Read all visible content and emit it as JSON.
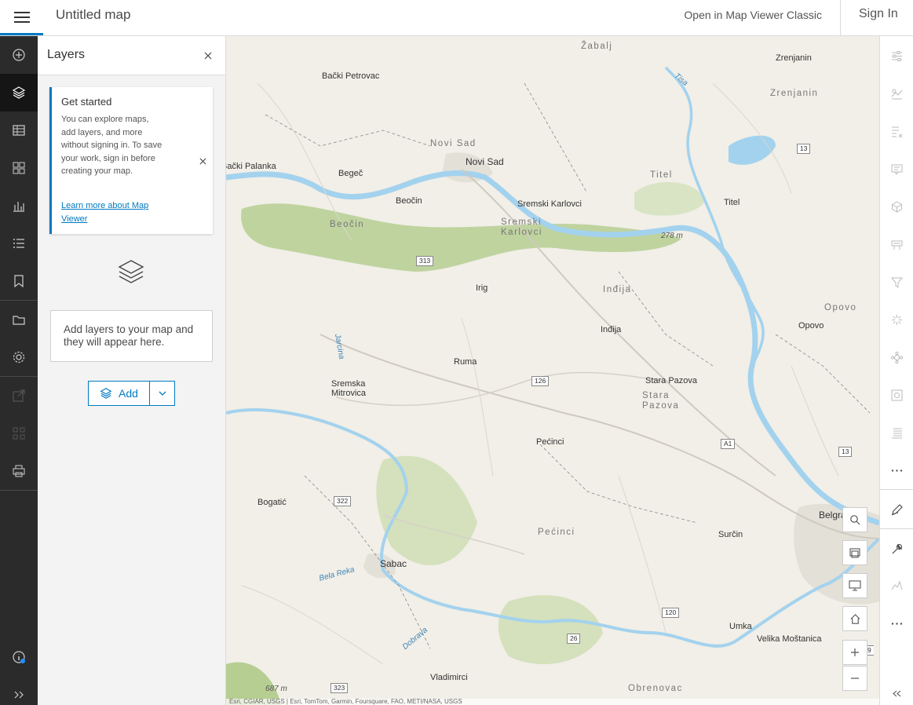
{
  "header": {
    "title": "Untitled map",
    "open_classic_label": "Open in Map Viewer Classic",
    "sign_in_label": "Sign In"
  },
  "left_rail": {
    "items": [
      {
        "icon": "add-circle-icon",
        "active": false
      },
      {
        "icon": "layers-icon",
        "active": true
      },
      {
        "icon": "table-icon",
        "active": false
      },
      {
        "icon": "grid-icon",
        "active": false
      },
      {
        "icon": "chart-icon",
        "active": false
      },
      {
        "icon": "legend-list-icon",
        "active": false
      },
      {
        "icon": "bookmark-icon",
        "active": false
      },
      {
        "icon": "folder-icon",
        "active": false
      },
      {
        "icon": "gear-icon",
        "active": false
      },
      {
        "icon": "share-icon",
        "active": false
      },
      {
        "icon": "apps-icon",
        "active": false
      },
      {
        "icon": "print-icon",
        "active": false
      },
      {
        "icon": "info-icon",
        "active": false
      },
      {
        "icon": "expand-icon",
        "active": false
      }
    ]
  },
  "layers_panel": {
    "title": "Layers",
    "get_started": {
      "title": "Get started",
      "body": "You can explore maps, add layers, and more without signing in. To save your work, sign in before creating your map.",
      "link": "Learn more about Map Viewer"
    },
    "empty_message": "Add layers to your map and they will appear here.",
    "add_label": "Add"
  },
  "map": {
    "place_labels": [
      "Zrenjanin",
      "Bački Petrovac",
      "Novi Sad",
      "Bački Palanka",
      "Begeč",
      "Beočin",
      "Sremski Karlovci",
      "Titel",
      "Irig",
      "Inđija",
      "Opovo",
      "Ruma",
      "Sremska Mitrovica",
      "Stara Pazova",
      "Pećinci",
      "Bogatić",
      "Surčin",
      "Sabac",
      "Umka",
      "Velika Moštanica",
      "Vladimirci",
      "Belgrade"
    ],
    "region_labels": [
      "Žabalj",
      "Zrenjanin",
      "Novi Sad",
      "Titel",
      "Beočin",
      "Sremski Karlovci",
      "Inđija",
      "Opovo",
      "Stara Pazova",
      "Pećinci",
      "Obrenovac"
    ],
    "water_labels": [
      "Tisa",
      "Jarcina",
      "Bela Reka",
      "Dobrava"
    ],
    "elevations": [
      "278 m",
      "687 m"
    ],
    "shields": [
      "13",
      "313",
      "126",
      "A1",
      "13",
      "322",
      "120",
      "26",
      "323",
      "9"
    ],
    "attribution": "Esri, CGIAR, USGS | Esri, TomTom, Garmin, Foursquare, FAO, METI/NASA, USGS"
  },
  "colors": {
    "accent": "#007ac2",
    "rail_bg": "#2b2b2b",
    "water": "#a3d2ee",
    "forest": "#b8cf9a"
  }
}
